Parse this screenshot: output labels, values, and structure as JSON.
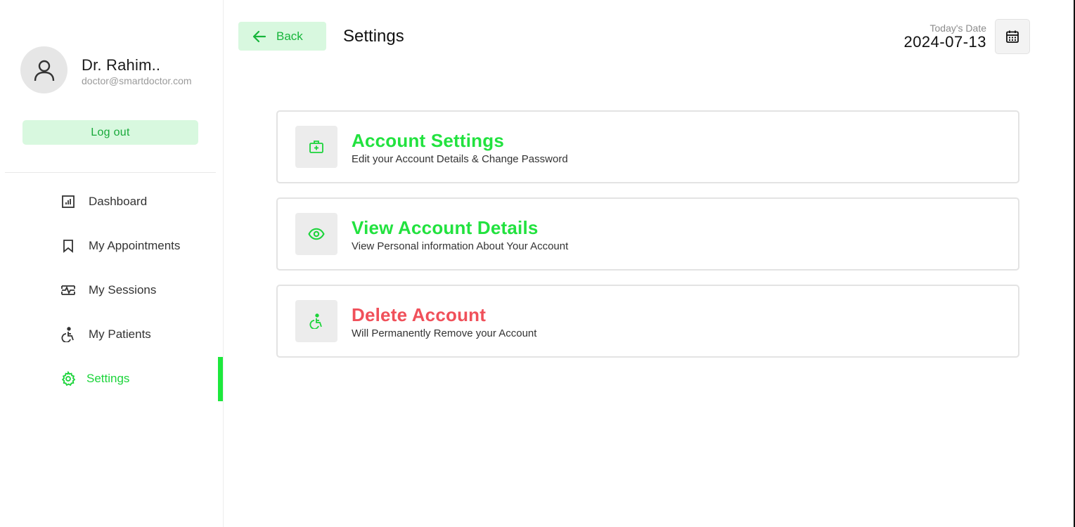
{
  "sidebar": {
    "profile": {
      "name": "Dr. Rahim..",
      "email": "doctor@smartdoctor.com"
    },
    "logout_label": "Log out",
    "items": [
      {
        "label": "Dashboard",
        "icon": "dashboard-icon"
      },
      {
        "label": "My Appointments",
        "icon": "bookmark-icon"
      },
      {
        "label": "My Sessions",
        "icon": "sessions-icon"
      },
      {
        "label": "My Patients",
        "icon": "wheelchair-icon"
      },
      {
        "label": "Settings",
        "icon": "gear-icon",
        "active": true
      }
    ]
  },
  "header": {
    "back_label": "Back",
    "title": "Settings",
    "date_label": "Today's Date",
    "date_value": "2024-07-13"
  },
  "cards": [
    {
      "title": "Account Settings",
      "subtitle": "Edit your Account Details & Change Password",
      "icon": "medical-bag-icon"
    },
    {
      "title": "View Account Details",
      "subtitle": "View Personal information About Your Account",
      "icon": "eye-icon"
    },
    {
      "title": "Delete Account",
      "subtitle": "Will Permanently Remove your Account",
      "icon": "wheelchair-icon",
      "danger": true
    }
  ],
  "colors": {
    "accent": "#1de83c",
    "accent_bg": "#d8f8df",
    "danger": "#f0505a"
  }
}
